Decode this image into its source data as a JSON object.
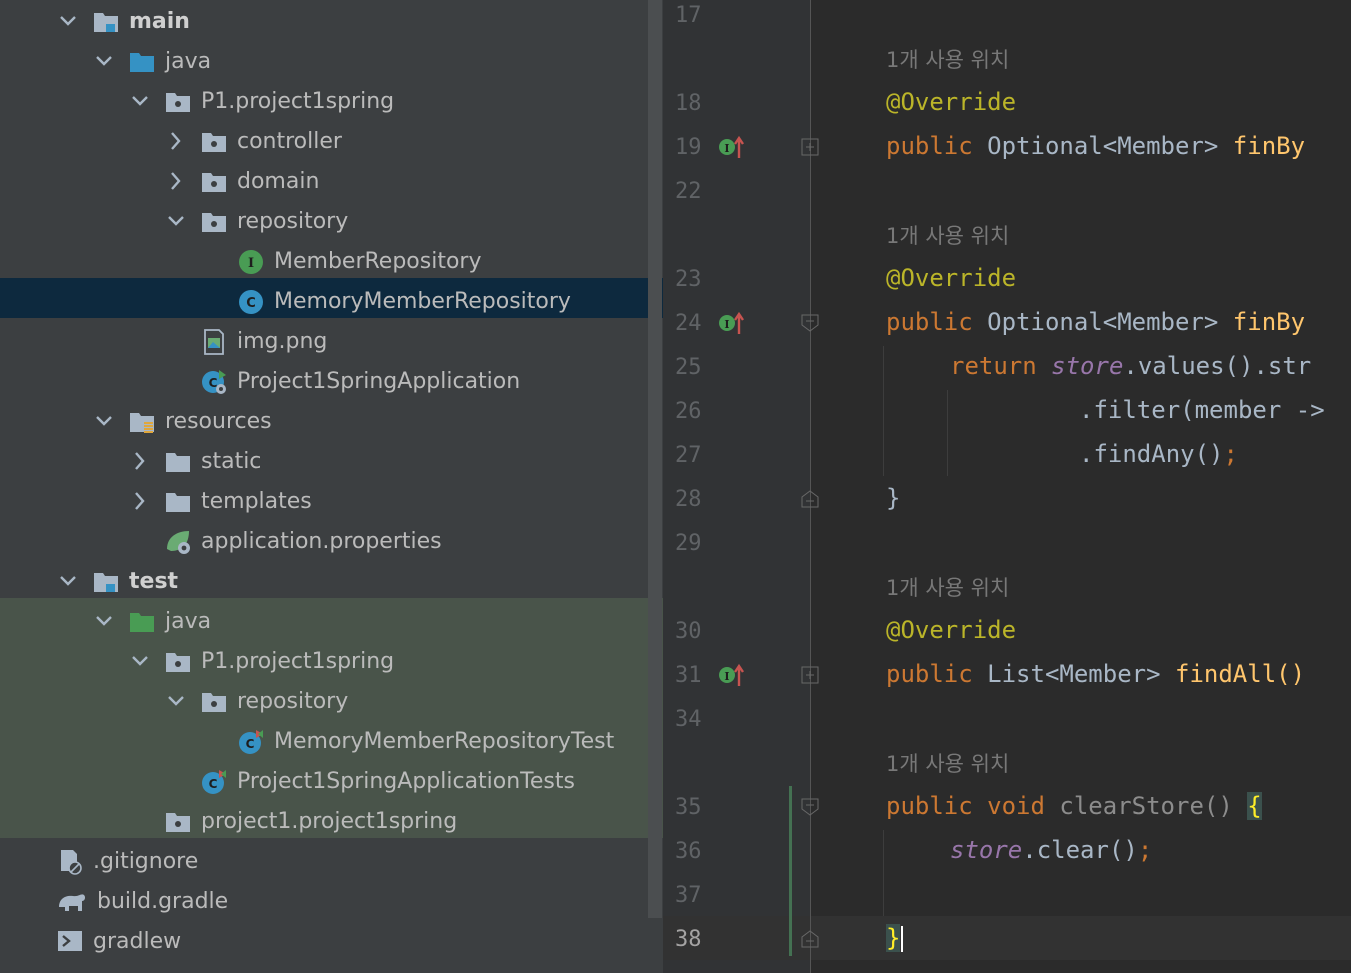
{
  "tree": {
    "rows": [
      {
        "label": "main",
        "arrow": "expanded",
        "icon": "folder-module-icon",
        "bold": true
      },
      {
        "label": "java",
        "arrow": "expanded",
        "icon": "folder-source-icon"
      },
      {
        "label": "P1.project1spring",
        "arrow": "expanded",
        "icon": "package-icon"
      },
      {
        "label": "controller",
        "arrow": "collapsed",
        "icon": "package-icon"
      },
      {
        "label": "domain",
        "arrow": "collapsed",
        "icon": "package-icon"
      },
      {
        "label": "repository",
        "arrow": "expanded",
        "icon": "package-icon"
      },
      {
        "label": "MemberRepository",
        "arrow": "none",
        "icon": "interface-icon"
      },
      {
        "label": "MemoryMemberRepository",
        "arrow": "none",
        "icon": "class-icon",
        "selected": true
      },
      {
        "label": "img.png",
        "arrow": "none",
        "icon": "image-file-icon"
      },
      {
        "label": "Project1SpringApplication",
        "arrow": "none",
        "icon": "spring-app-class-icon"
      },
      {
        "label": "resources",
        "arrow": "expanded",
        "icon": "folder-resources-icon"
      },
      {
        "label": "static",
        "arrow": "collapsed",
        "icon": "folder-icon"
      },
      {
        "label": "templates",
        "arrow": "collapsed",
        "icon": "folder-icon"
      },
      {
        "label": "application.properties",
        "arrow": "none",
        "icon": "spring-properties-icon"
      },
      {
        "label": "test",
        "arrow": "expanded",
        "icon": "folder-module-icon",
        "bold": true
      },
      {
        "label": "java",
        "arrow": "expanded",
        "icon": "folder-test-source-icon"
      },
      {
        "label": "P1.project1spring",
        "arrow": "expanded",
        "icon": "package-icon"
      },
      {
        "label": "repository",
        "arrow": "expanded",
        "icon": "package-icon"
      },
      {
        "label": "MemoryMemberRepositoryTest",
        "arrow": "none",
        "icon": "test-class-icon"
      },
      {
        "label": "Project1SpringApplicationTests",
        "arrow": "none",
        "icon": "test-class-icon"
      },
      {
        "label": "project1.project1spring",
        "arrow": "none",
        "icon": "package-icon"
      },
      {
        "label": ".gitignore",
        "arrow": "none",
        "icon": "gitignore-file-icon"
      },
      {
        "label": "build.gradle",
        "arrow": "none",
        "icon": "gradle-elephant-icon"
      },
      {
        "label": "gradlew",
        "arrow": "none",
        "icon": "shell-script-icon"
      }
    ]
  },
  "editor": {
    "usage_hint": "1개 사용 위치",
    "line_numbers": [
      "17",
      "18",
      "19",
      "22",
      "23",
      "24",
      "25",
      "26",
      "27",
      "28",
      "29",
      "30",
      "31",
      "34",
      "35",
      "36",
      "37",
      "38"
    ],
    "current_line": "38",
    "lines": {
      "l19": {
        "kw": "public",
        "type": "Optional<Member>",
        "fn": "finBy"
      },
      "l24": {
        "kw": "public",
        "type": "Optional<Member>",
        "fn": "finBy"
      },
      "l25": {
        "kw": "return",
        "field": "store",
        "rest": ".values().str"
      },
      "l26": {
        "text": ".filter(member ->"
      },
      "l27": {
        "text": ".findAny()",
        "semi": ";"
      },
      "l28": {
        "text": "}"
      },
      "l31": {
        "kw": "public",
        "type": "List<Member>",
        "fn": "findAll()"
      },
      "l35": {
        "kw1": "public",
        "kw2": "void",
        "fn": "clearStore()",
        "brace": "{"
      },
      "l36": {
        "field": "store",
        "rest": ".clear()",
        "semi": ";"
      },
      "l38": {
        "brace": "}"
      },
      "annotation": "@Override"
    }
  },
  "colors": {
    "tree_bg": "#3c3f41",
    "selected_row": "#0d293e",
    "test_bg": "#49544a",
    "editor_bg": "#2b2b2b",
    "keyword": "#cc7832",
    "annotation": "#bbb529",
    "method": "#ffc66d",
    "field": "#9876aa"
  }
}
